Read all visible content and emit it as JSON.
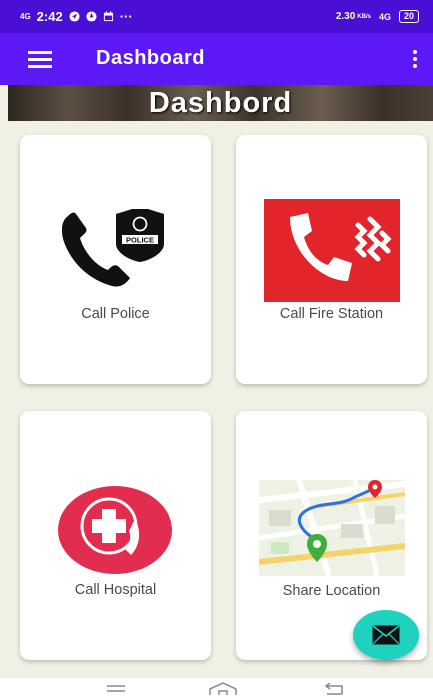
{
  "status_bar": {
    "network": "4G",
    "time": "2:42",
    "more": "···",
    "speed": "2.30",
    "speed_unit": "KB/s",
    "network_right": "4G",
    "battery": "20"
  },
  "app_bar": {
    "title": "Dashboard"
  },
  "banner": {
    "title": "Dashbord"
  },
  "cards": [
    {
      "label": "Call Police"
    },
    {
      "label": "Call Fire Station"
    },
    {
      "label": "Call Hospital"
    },
    {
      "label": "Share Location"
    }
  ],
  "colors": {
    "status_bar": "#4a0fd4",
    "app_bar": "#5c18f5",
    "background": "#f1f0e4",
    "fab": "#1fd2c0",
    "fire_red": "#e2252b",
    "hospital_red": "#e32d4e"
  }
}
